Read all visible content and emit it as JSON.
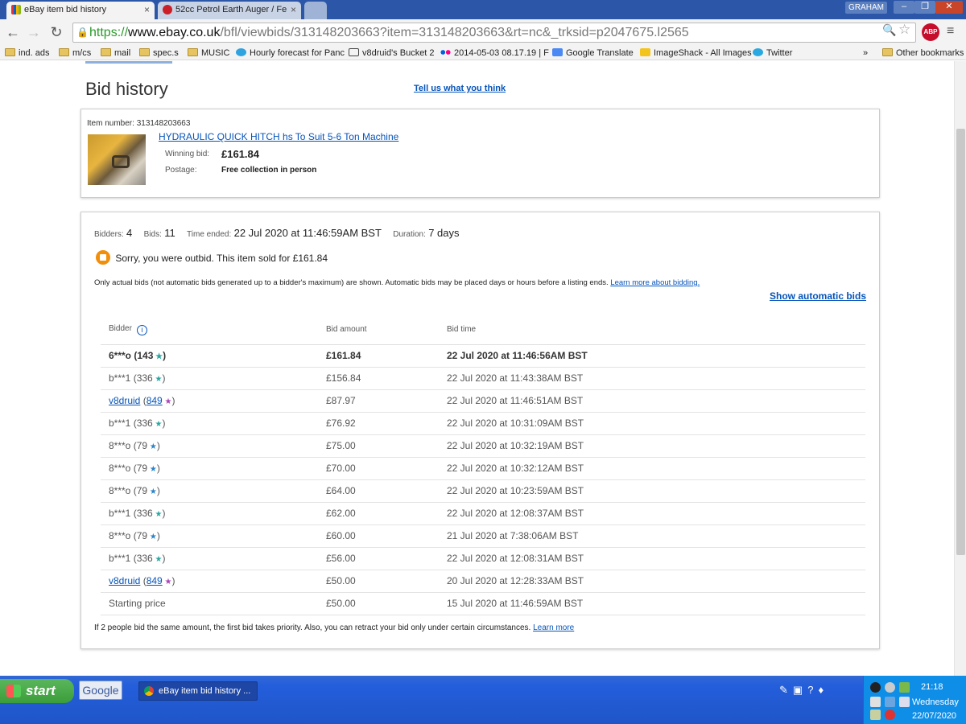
{
  "browser": {
    "tabs": [
      {
        "title": "eBay item bid history",
        "close": "×"
      },
      {
        "title": "52cc Petrol Earth Auger / Fe",
        "close": "×"
      }
    ],
    "user": "GRAHAM",
    "window_buttons": [
      "–",
      "❐",
      "✕"
    ],
    "url": {
      "scheme": "https://",
      "host": "www.ebay.co.uk",
      "path": "/bfl/viewbids/313148203663?item=313148203663&rt=nc&_trksid=p2047675.l2565"
    },
    "abp_label": "ABP",
    "bookmarks": [
      "ind. ads",
      "m/cs",
      "mail",
      "spec.s",
      "MUSIC",
      "Hourly forecast for Panc",
      "v8druid's Bucket 2",
      "2014-05-03 08.17.19 | F",
      "Google Translate",
      "ImageShack - All Images",
      "Twitter"
    ],
    "bookmarks_more": "»",
    "other_bookmarks": "Other bookmarks"
  },
  "page": {
    "title": "Bid history",
    "feedback_link": "Tell us what you think",
    "item": {
      "number_text": "Item number: 313148203663",
      "title": "HYDRAULIC QUICK HITCH hs To  Suit 5-6 Ton Machine",
      "winning_label": "Winning bid:",
      "winning_value": "£161.84",
      "postage_label": "Postage:",
      "postage_value": "Free collection in person"
    },
    "summary": {
      "bidders_label": "Bidders:",
      "bidders": "4",
      "bids_label": "Bids:",
      "bids": "11",
      "time_label": "Time ended:",
      "time_value": "22 Jul 2020 at 11:46:59AM BST",
      "duration_label": "Duration:",
      "duration_value": "7 days"
    },
    "outbid_message": "Sorry, you were outbid. This item sold for £161.84",
    "note": "Only actual bids (not automatic bids generated up to a bidder's maximum) are shown. Automatic bids may be placed days or hours before a listing ends.",
    "note_link": "Learn more about bidding.",
    "show_auto": "Show automatic bids",
    "columns": {
      "bidder": "Bidder",
      "amount": "Bid amount",
      "time": "Bid time",
      "info_icon": "i"
    },
    "rows": [
      {
        "bidder": "6***o",
        "score": "143",
        "star": "teal",
        "amount": "£161.84",
        "time": "22 Jul 2020 at 11:46:56AM BST",
        "winner": true
      },
      {
        "bidder": "b***1",
        "score": "336",
        "star": "teal",
        "amount": "£156.84",
        "time": "22 Jul 2020 at 11:43:38AM BST"
      },
      {
        "bidder": "v8druid",
        "score": "849",
        "star": "purple",
        "amount": "£87.97",
        "time": "22 Jul 2020 at 11:46:51AM BST",
        "link": true
      },
      {
        "bidder": "b***1",
        "score": "336",
        "star": "teal",
        "amount": "£76.92",
        "time": "22 Jul 2020 at 10:31:09AM BST"
      },
      {
        "bidder": "8***o",
        "score": "79",
        "star": "blue",
        "amount": "£75.00",
        "time": "22 Jul 2020 at 10:32:19AM BST"
      },
      {
        "bidder": "8***o",
        "score": "79",
        "star": "blue",
        "amount": "£70.00",
        "time": "22 Jul 2020 at 10:32:12AM BST"
      },
      {
        "bidder": "8***o",
        "score": "79",
        "star": "blue",
        "amount": "£64.00",
        "time": "22 Jul 2020 at 10:23:59AM BST"
      },
      {
        "bidder": "b***1",
        "score": "336",
        "star": "teal",
        "amount": "£62.00",
        "time": "22 Jul 2020 at 12:08:37AM BST"
      },
      {
        "bidder": "8***o",
        "score": "79",
        "star": "blue",
        "amount": "£60.00",
        "time": "21 Jul 2020 at 7:38:06AM BST"
      },
      {
        "bidder": "b***1",
        "score": "336",
        "star": "teal",
        "amount": "£56.00",
        "time": "22 Jul 2020 at 12:08:31AM BST"
      },
      {
        "bidder": "v8druid",
        "score": "849",
        "star": "purple",
        "amount": "£50.00",
        "time": "20 Jul 2020 at 12:28:33AM BST",
        "link": true
      },
      {
        "bidder": "Starting price",
        "amount": "£50.00",
        "time": "15 Jul 2020 at 11:46:59AM BST"
      }
    ],
    "footnote": "If 2 people bid the same amount, the first bid takes priority. Also, you can retract your bid only under certain circumstances.",
    "footnote_link": "Learn more"
  },
  "taskbar": {
    "start_label": "start",
    "google_label": "Google",
    "window_title": "eBay item bid history ...",
    "clock_time": "21:18",
    "clock_day": "Wednesday",
    "clock_date": "22/07/2020"
  }
}
